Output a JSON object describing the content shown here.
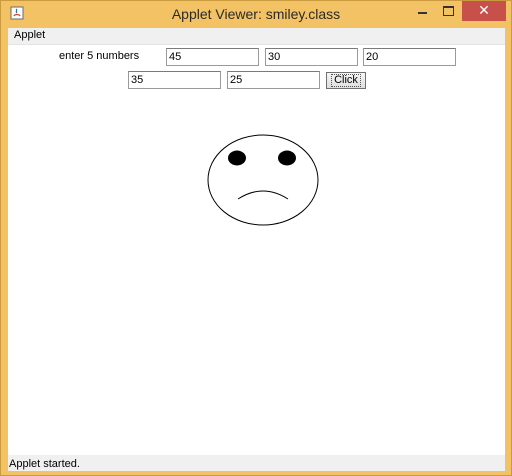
{
  "window": {
    "title": "Applet Viewer: smiley.class",
    "close_glyph": "✕"
  },
  "menu": {
    "items": [
      "Applet"
    ]
  },
  "form": {
    "prompt": "enter 5 numbers",
    "fields": [
      "45",
      "30",
      "20",
      "35",
      "25"
    ],
    "button_label": "Click"
  },
  "drawing": {
    "face": "frowning-face",
    "stroke_color": "#000000",
    "fill_color": "#ffffff"
  },
  "status": {
    "text": "Applet started."
  },
  "colors": {
    "titlebar": "#f3c264",
    "close_button": "#c7504b",
    "panel": "#f0f0f0"
  },
  "icons": [
    "java-applet-icon",
    "minimize-icon",
    "maximize-icon",
    "close-icon"
  ]
}
